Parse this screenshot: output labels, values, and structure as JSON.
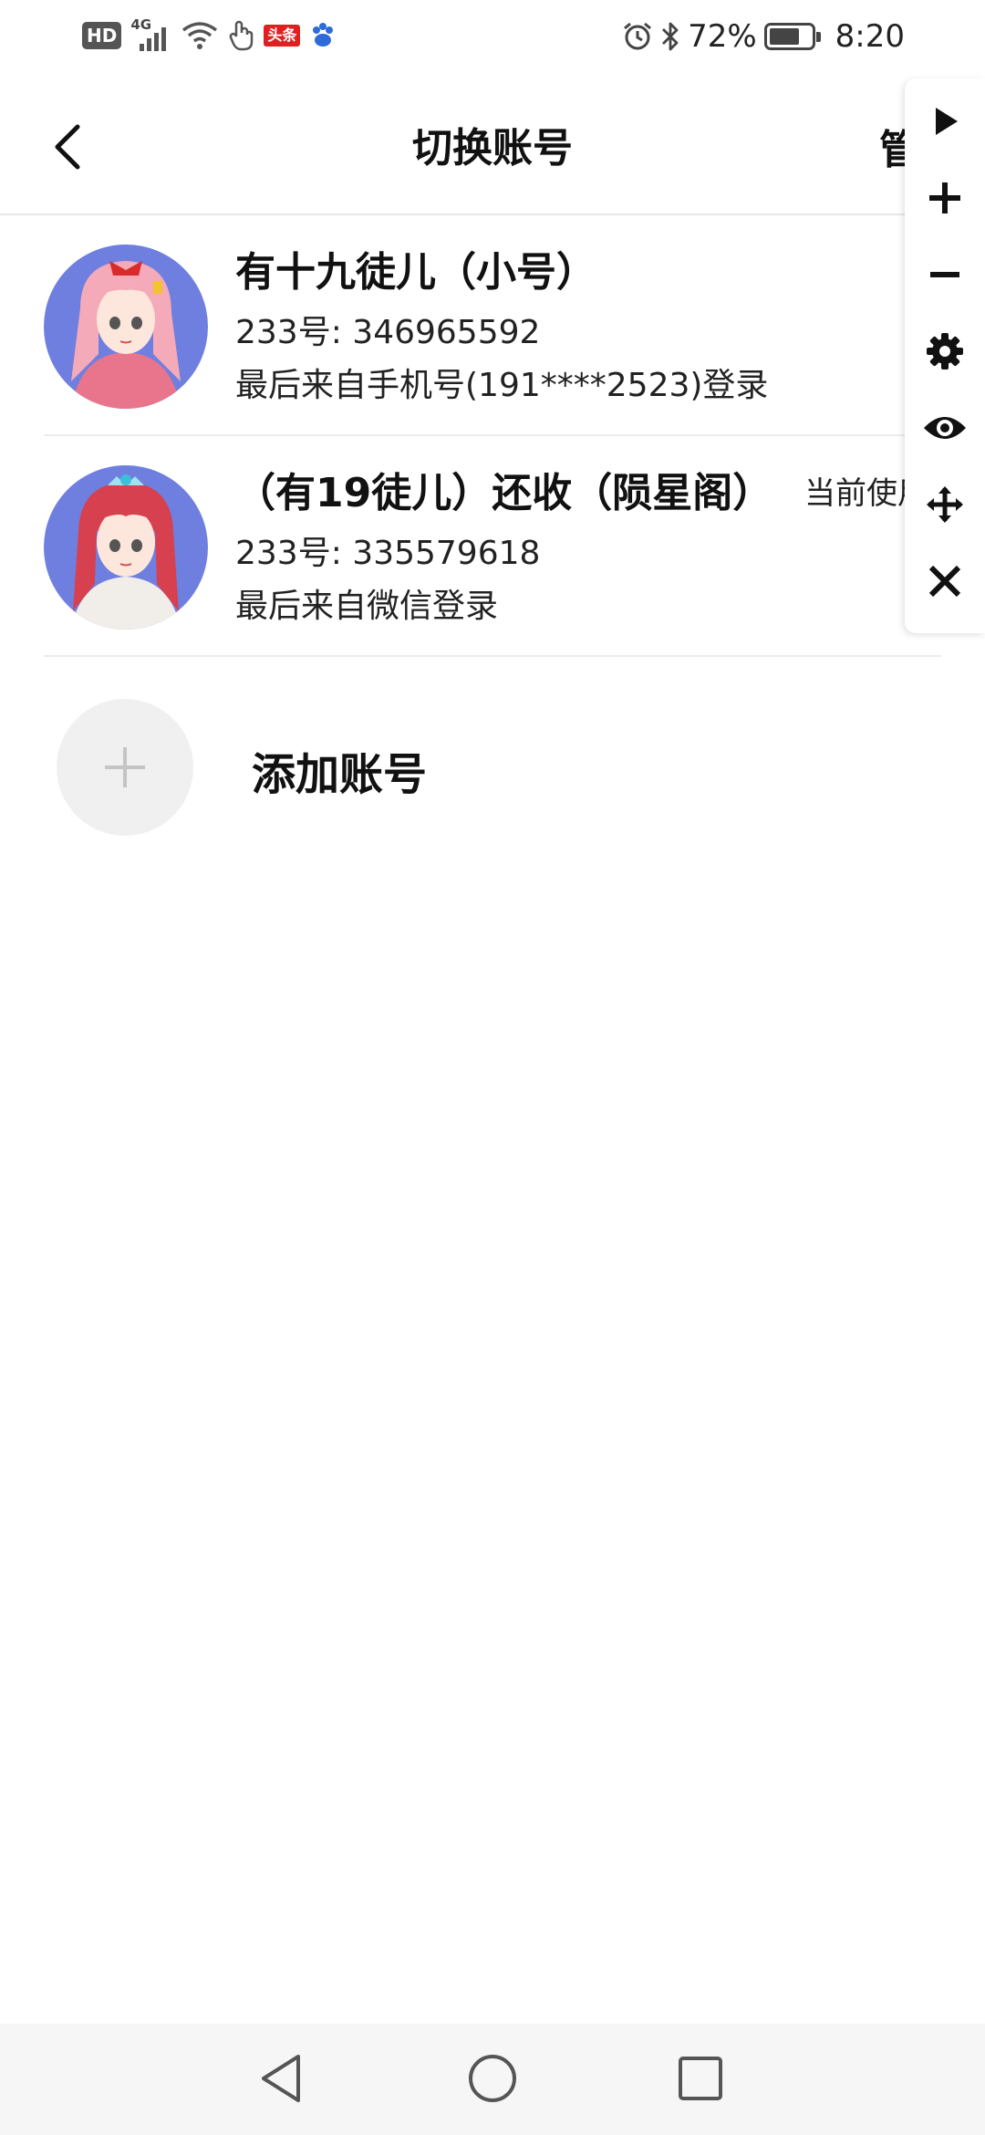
{
  "status_bar": {
    "hd": "HD",
    "network": "4G",
    "toutiao": "头条",
    "battery_text": "72%",
    "battery_level": 0.72,
    "time": "8:20"
  },
  "header": {
    "title": "切换账号",
    "manage": "管理",
    "back_icon": "chevron-left-icon"
  },
  "accounts": [
    {
      "name": "有十九徒儿（小号）",
      "id": "233号: 346965592",
      "login": "最后来自手机号(191****2523)登录",
      "current": ""
    },
    {
      "name": "（有19徒儿）还收（陨星阁）",
      "id": "233号: 335579618",
      "login": "最后来自微信登录",
      "current": "当前使用"
    }
  ],
  "add_account": {
    "label": "添加账号",
    "icon": "plus-icon"
  },
  "tool_panel": {
    "icons": [
      "play-icon",
      "plus-icon",
      "minus-icon",
      "gear-icon",
      "eye-icon",
      "move-icon",
      "close-icon"
    ]
  },
  "nav": {
    "icons": [
      "back-triangle-icon",
      "home-circle-icon",
      "recents-square-icon"
    ]
  },
  "colors": {
    "avatar_bg": "#6f7fe0",
    "divider": "#ececec",
    "add_circle": "#f0f0f0"
  }
}
